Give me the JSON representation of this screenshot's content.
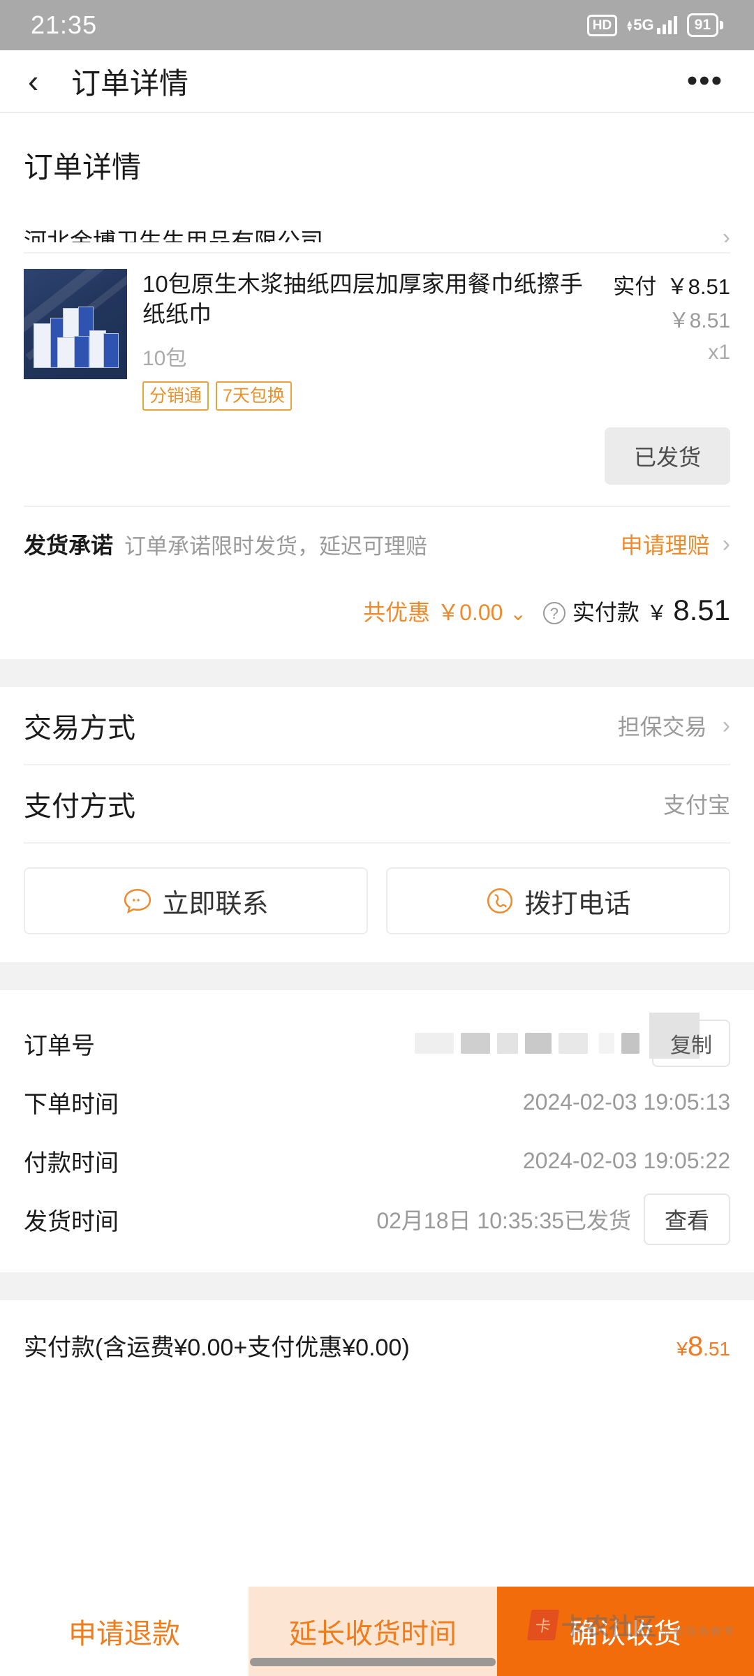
{
  "status_bar": {
    "time": "21:35",
    "hd": "HD",
    "network": "5G",
    "battery": "91"
  },
  "nav": {
    "back_icon": "chevron-left-icon",
    "title": "订单详情",
    "more_icon": "more-horizontal-icon"
  },
  "page": {
    "heading": "订单详情"
  },
  "shop": {
    "name": "河北金博卫生生用品有限公司",
    "chevron": "›"
  },
  "product": {
    "title": "10包原生木浆抽纸四层加厚家用餐巾纸擦手纸纸巾",
    "pay_label": "实付",
    "pay_price": "￥8.51",
    "unit_price": "￥8.51",
    "spec": "10包",
    "quantity": "x1",
    "tags": [
      "分销通",
      "7天包换"
    ],
    "status_badge": "已发货"
  },
  "promise": {
    "label": "发货承诺",
    "text": "订单承诺限时发货，延迟可理赔",
    "link": "申请理赔",
    "chevron": "›"
  },
  "discount": {
    "label": "共优惠",
    "amount": "￥0.00",
    "caret": "⌄",
    "help_icon": "question-circle-icon",
    "paid_label": "实付款",
    "paid_currency": "￥",
    "paid_amount": "8.51"
  },
  "info_rows": [
    {
      "key": "交易方式",
      "value": "担保交易",
      "chevron": "›"
    },
    {
      "key": "支付方式",
      "value": "支付宝",
      "chevron": ""
    }
  ],
  "contact": {
    "chat_icon": "chat-bubble-icon",
    "chat_label": "立即联系",
    "phone_icon": "phone-icon",
    "phone_label": "拨打电话"
  },
  "order_info": {
    "order_no_key": "订单号",
    "order_no_value": "",
    "copy_label": "复制",
    "create_time_key": "下单时间",
    "create_time_value": "2024-02-03 19:05:13",
    "pay_time_key": "付款时间",
    "pay_time_value": "2024-02-03 19:05:22",
    "ship_time_key": "发货时间",
    "ship_time_value": "02月18日 10:35:35已发货",
    "view_label": "查看"
  },
  "total": {
    "label": "实付款(含运费¥0.00+支付优惠¥0.00)",
    "currency": "¥",
    "amount": "8",
    "cents": ".51"
  },
  "bottom_actions": [
    {
      "label": "申请退款"
    },
    {
      "label": "延长收货时间"
    },
    {
      "label": "确认收货"
    }
  ],
  "watermark": {
    "logo": "卡",
    "main": "卡农社区",
    "sub": "金融服务教育"
  },
  "colors": {
    "accent_orange": "#f07c1c",
    "confirm_orange": "#f36c0c",
    "extend_bg": "#fce5d2",
    "tag_border": "#e8a33d",
    "total_orange": "#f47920",
    "status_bar_bg": "#a9a9a9"
  }
}
